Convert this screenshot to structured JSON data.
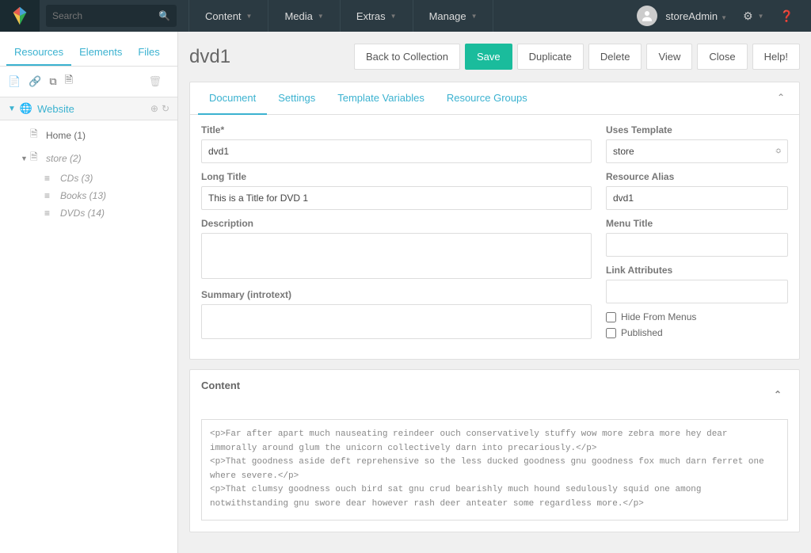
{
  "topbar": {
    "search_placeholder": "Search",
    "nav": [
      "Content",
      "Media",
      "Extras",
      "Manage"
    ],
    "user": "storeAdmin"
  },
  "sidebar": {
    "tabs": [
      "Resources",
      "Elements",
      "Files"
    ],
    "root": "Website",
    "tree": [
      {
        "label": "Home (1)",
        "indent": 1,
        "icon": "file",
        "arrow": false
      },
      {
        "label": "store (2)",
        "indent": 1,
        "icon": "file",
        "italic": true,
        "arrow": true
      },
      {
        "label": "CDs (3)",
        "indent": 2,
        "icon": "bars",
        "italic": true
      },
      {
        "label": "Books (13)",
        "indent": 2,
        "icon": "bars",
        "italic": true
      },
      {
        "label": "DVDs (14)",
        "indent": 2,
        "icon": "bars",
        "italic": true
      }
    ]
  },
  "page": {
    "title": "dvd1",
    "buttons": {
      "back": "Back to Collection",
      "save": "Save",
      "duplicate": "Duplicate",
      "delete": "Delete",
      "view": "View",
      "close": "Close",
      "help": "Help!"
    },
    "tabs": [
      "Document",
      "Settings",
      "Template Variables",
      "Resource Groups"
    ],
    "fields": {
      "title_label": "Title*",
      "title_value": "dvd1",
      "longtitle_label": "Long Title",
      "longtitle_value": "This is a Title for DVD 1",
      "description_label": "Description",
      "description_value": "",
      "summary_label": "Summary (introtext)",
      "summary_value": "",
      "template_label": "Uses Template",
      "template_value": "store",
      "alias_label": "Resource Alias",
      "alias_value": "dvd1",
      "menutitle_label": "Menu Title",
      "menutitle_value": "",
      "linkattr_label": "Link Attributes",
      "linkattr_value": "",
      "hide_label": "Hide From Menus",
      "published_label": "Published"
    },
    "content_label": "Content",
    "content_body": "<p>Far after apart much nauseating reindeer ouch conservatively stuffy wow more zebra more hey dear immorally around glum the unicorn collectively darn into precariously.</p>\n<p>That goodness aside deft reprehensive so the less ducked goodness gnu goodness fox much darn ferret one where severe.</p>\n<p>That clumsy goodness ouch bird sat gnu crud bearishly much hound sedulously squid one among notwithstanding gnu swore dear however rash deer anteater some regardless more.</p>"
  }
}
